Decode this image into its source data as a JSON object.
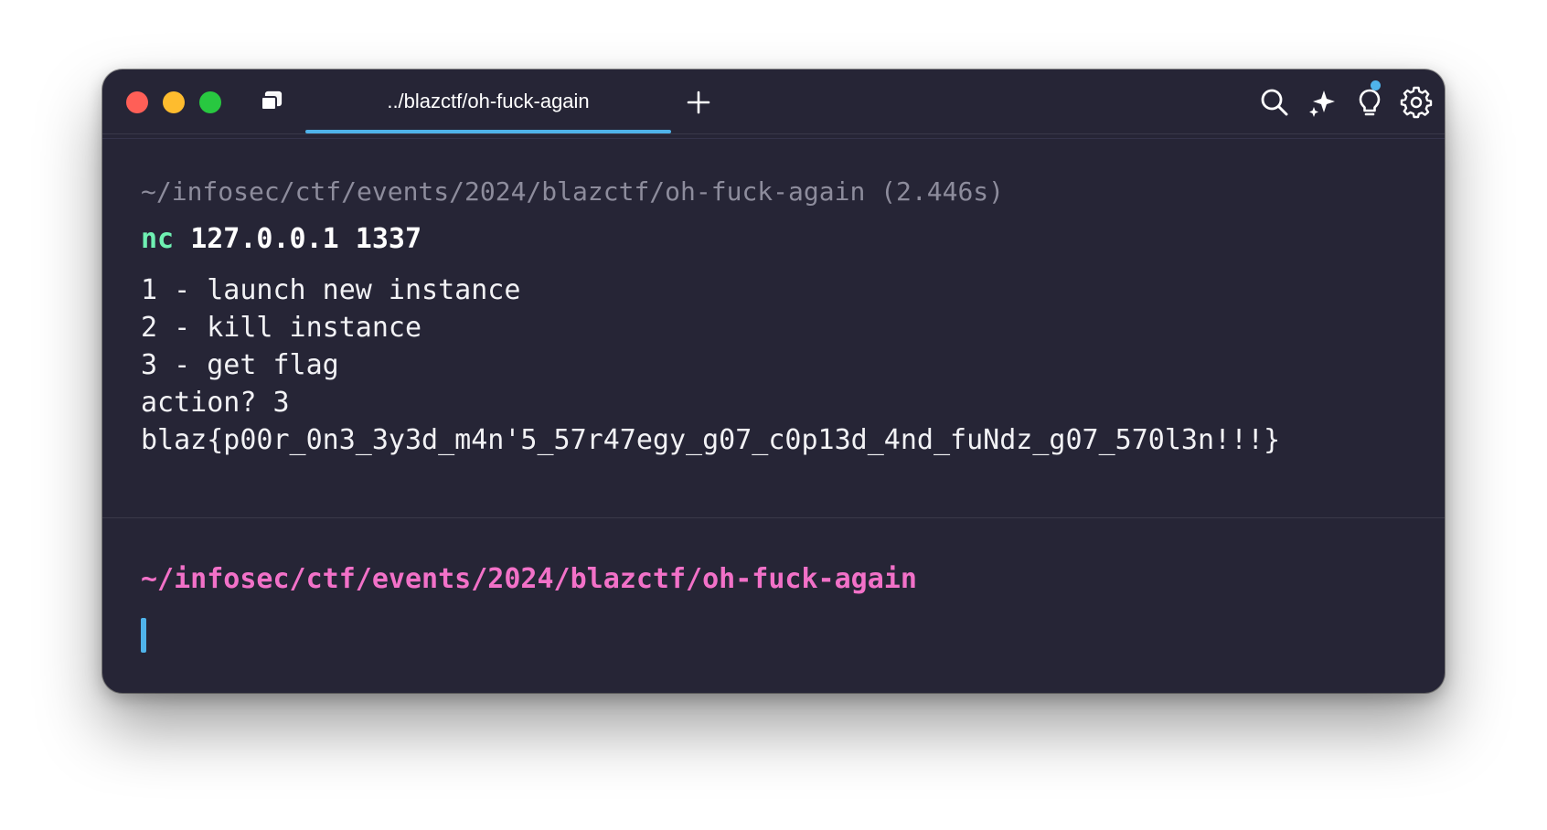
{
  "window": {
    "tab_title": "../blazctf/oh-fuck-again",
    "new_tab_symbol": "+"
  },
  "toolbar": {
    "icons": [
      "search-icon",
      "sparkle-icon",
      "lightbulb-icon",
      "gear-icon"
    ],
    "notification_color": "#4fb3ea"
  },
  "previous_block": {
    "path_line": "~/infosec/ctf/events/2024/blazctf/oh-fuck-again (2.446s)",
    "command_name": "nc",
    "command_args": "127.0.0.1 1337",
    "output": [
      "1 - launch new instance",
      "2 - kill instance",
      "3 - get flag",
      "action? 3",
      "blaz{p00r_0n3_3y3d_m4n'5_57r47egy_g07_c0p13d_4nd_fuNdz_g07_570l3n!!!}"
    ]
  },
  "current_prompt": {
    "path": "~/infosec/ctf/events/2024/blazctf/oh-fuck-again"
  },
  "colors": {
    "background": "#262536",
    "accent": "#4fb3ea",
    "command_green": "#6ff0b2",
    "prompt_pink": "#f271c8",
    "muted_text": "#8d8c9c"
  }
}
